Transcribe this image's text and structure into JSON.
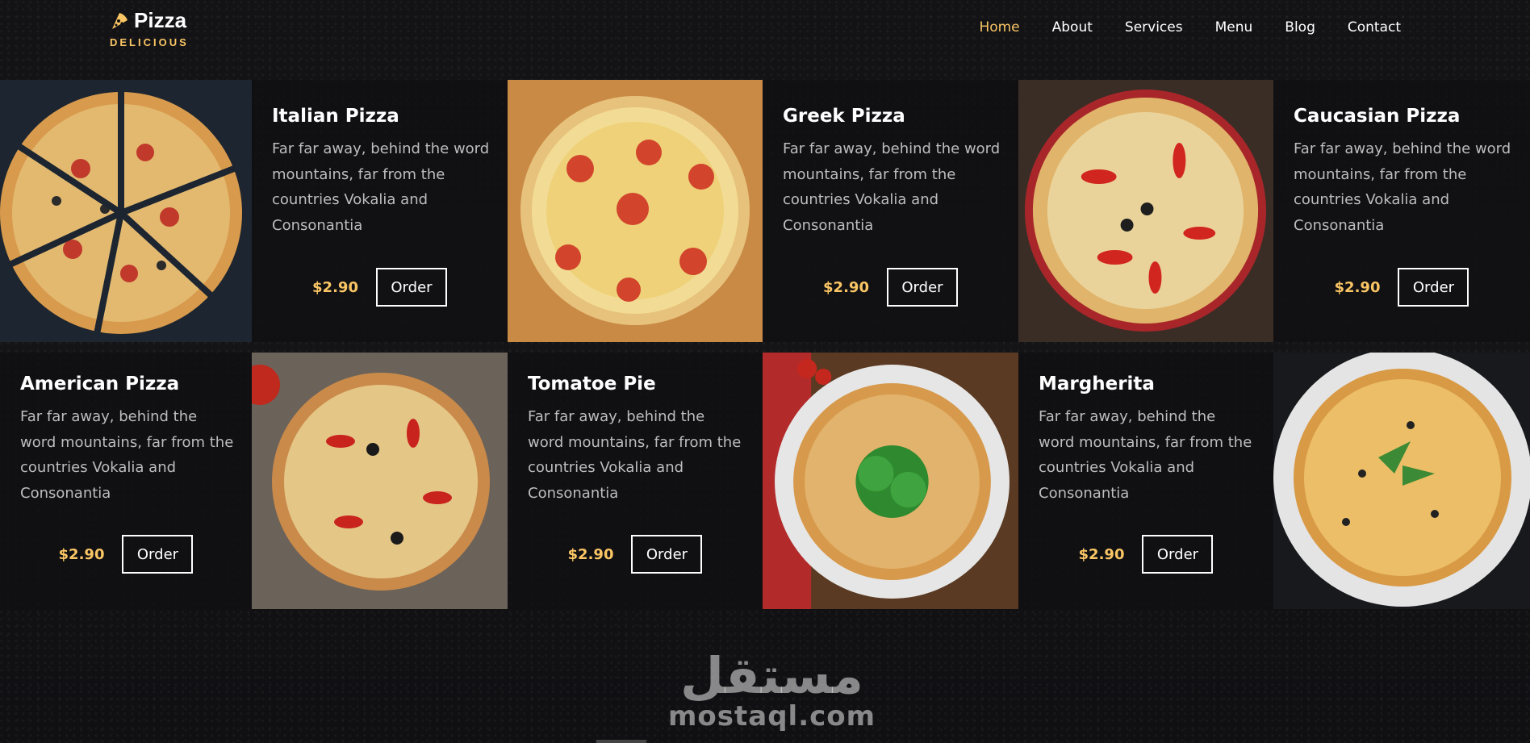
{
  "brand": {
    "title": "Pizza",
    "subtitle": "DELICIOUS",
    "accent": "#fac564"
  },
  "nav": [
    {
      "label": "Home",
      "active": true
    },
    {
      "label": "About",
      "active": false
    },
    {
      "label": "Services",
      "active": false
    },
    {
      "label": "Menu",
      "active": false
    },
    {
      "label": "Blog",
      "active": false
    },
    {
      "label": "Contact",
      "active": false
    }
  ],
  "menu": [
    {
      "name": "Italian Pizza",
      "description": "Far far away, behind the word mountains, far from the countries Vokalia and Consonantia",
      "price": "$2.90",
      "order_label": "Order",
      "image": "pizza-slices-photo"
    },
    {
      "name": "Greek Pizza",
      "description": "Far far away, behind the word mountains, far from the countries Vokalia and Consonantia",
      "price": "$2.90",
      "order_label": "Order",
      "image": "pizza-tomato-corn-photo"
    },
    {
      "name": "Caucasian Pizza",
      "description": "Far far away, behind the word mountains, far from the countries Vokalia and Consonantia",
      "price": "$2.90",
      "order_label": "Order",
      "image": "pizza-red-pepper-photo"
    },
    {
      "name": "American Pizza",
      "description": "Far far away, behind the word mountains, far from the countries Vokalia and Consonantia",
      "price": "$2.90",
      "order_label": "Order",
      "image": "pizza-flour-photo"
    },
    {
      "name": "Tomatoe Pie",
      "description": "Far far away, behind the word mountains, far from the countries Vokalia and Consonantia",
      "price": "$2.90",
      "order_label": "Order",
      "image": "pizza-basil-plate-photo"
    },
    {
      "name": "Margherita",
      "description": "Far far away, behind the word mountains, far from the countries Vokalia and Consonantia",
      "price": "$2.90",
      "order_label": "Order",
      "image": "pizza-cheese-plate-photo"
    }
  ],
  "watermark": {
    "arabic": "مستقل",
    "latin": "mostaql.com"
  }
}
